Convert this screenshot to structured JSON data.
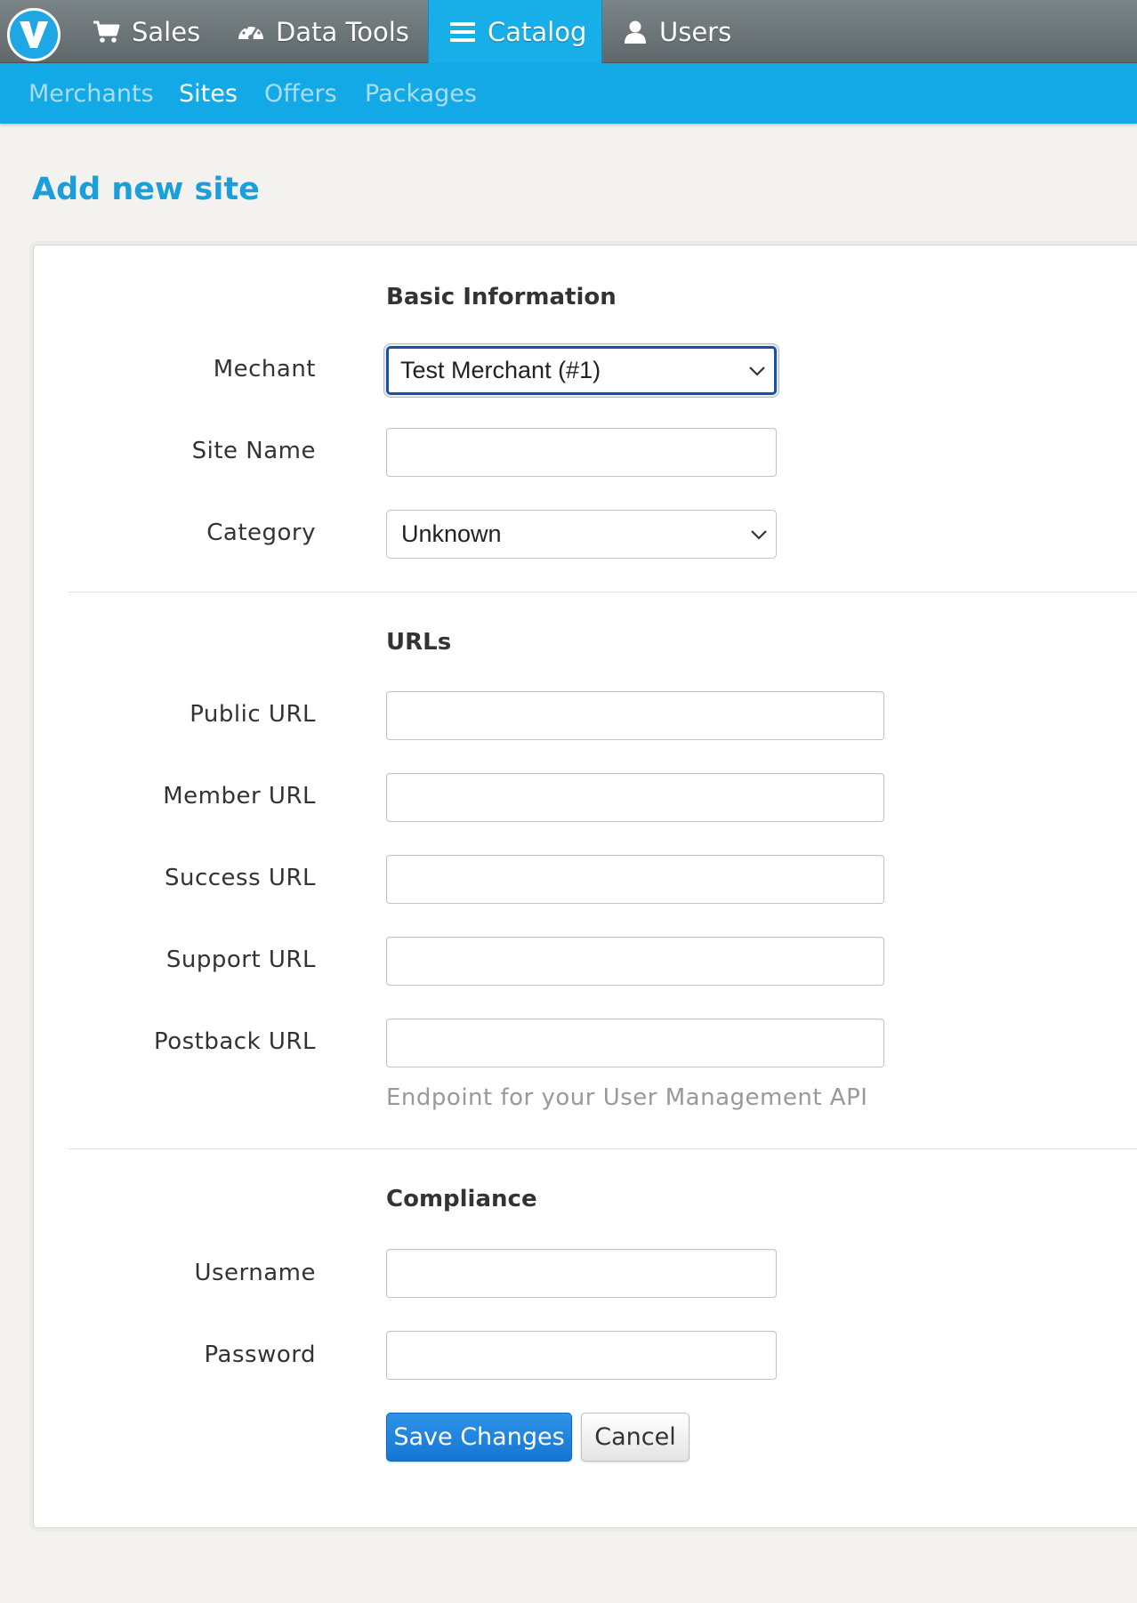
{
  "topnav": {
    "logo_letter": "V",
    "items": [
      {
        "label": "Sales",
        "icon": "cart-icon",
        "active": false
      },
      {
        "label": "Data Tools",
        "icon": "dashboard-icon",
        "active": false
      },
      {
        "label": "Catalog",
        "icon": "list-icon",
        "active": true
      },
      {
        "label": "Users",
        "icon": "user-icon",
        "active": false
      }
    ]
  },
  "subnav": {
    "items": [
      {
        "label": "Merchants",
        "active": false
      },
      {
        "label": "Sites",
        "active": true
      },
      {
        "label": "Offers",
        "active": false
      },
      {
        "label": "Packages",
        "active": false
      }
    ]
  },
  "page": {
    "title": "Add new site"
  },
  "form": {
    "basic": {
      "title": "Basic Information",
      "merchant_label": "Mechant",
      "merchant_value": "Test Merchant (#1)",
      "site_name_label": "Site Name",
      "site_name_value": "",
      "category_label": "Category",
      "category_value": "Unknown"
    },
    "urls": {
      "title": "URLs",
      "public_label": "Public URL",
      "member_label": "Member URL",
      "success_label": "Success URL",
      "support_label": "Support URL",
      "postback_label": "Postback URL",
      "postback_help": "Endpoint for your User Management API"
    },
    "compliance": {
      "title": "Compliance",
      "username_label": "Username",
      "password_label": "Password"
    },
    "actions": {
      "save_label": "Save Changes",
      "cancel_label": "Cancel"
    }
  },
  "colors": {
    "topbar": "#6d7679",
    "accent": "#12a9e6",
    "title": "#1a9fda",
    "primary_button": "#1f82dc"
  }
}
